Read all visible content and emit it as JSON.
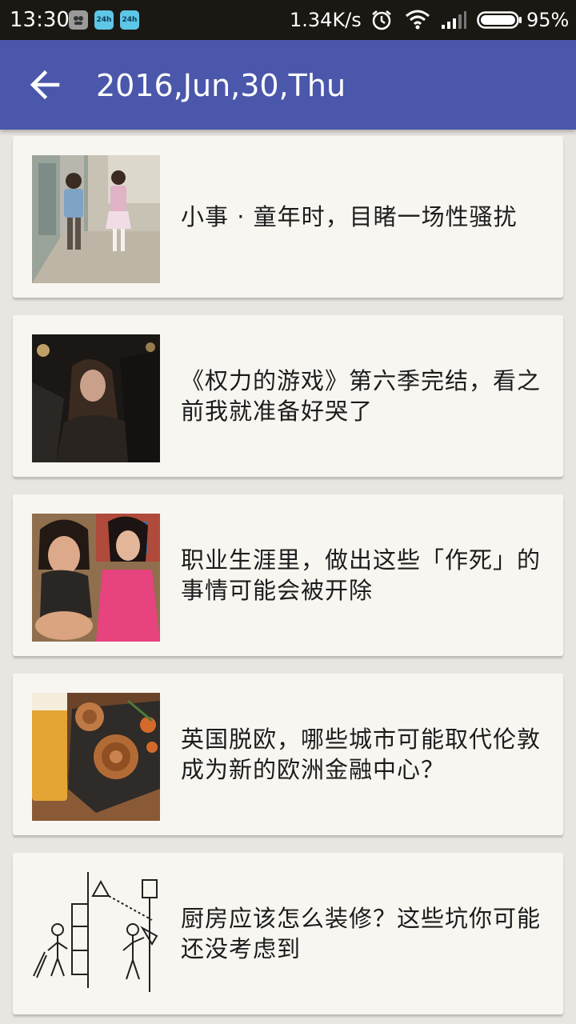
{
  "status_bar": {
    "time": "13:30",
    "notifications": [
      "app-icon",
      "24h-icon",
      "24h-icon"
    ],
    "notification_labels": [
      "",
      "24h",
      "24h"
    ],
    "net_speed": "1.34K/s",
    "battery_percent": "95%",
    "battery_level": 0.95
  },
  "app_bar": {
    "title": "2016,Jun,30,Thu",
    "back_icon": "arrow-left-icon",
    "color": "#4a57aa"
  },
  "articles": [
    {
      "title": "小事 · 童年时，目睹一场性骚扰",
      "thumb": "children-walking-photo"
    },
    {
      "title": "《权力的游戏》第六季完结，看之前我就准备好哭了",
      "thumb": "game-of-thrones-still"
    },
    {
      "title": "职业生涯里，做出这些「作死」的事情可能会被开除",
      "thumb": "two-women-photo"
    },
    {
      "title": "英国脱欧，哪些城市可能取代伦敦成为新的欧洲金融中心？",
      "thumb": "beer-sausage-photo"
    },
    {
      "title": "厨房应该怎么装修？这些坑你可能还没考虑到",
      "thumb": "kitchen-sketch"
    }
  ]
}
